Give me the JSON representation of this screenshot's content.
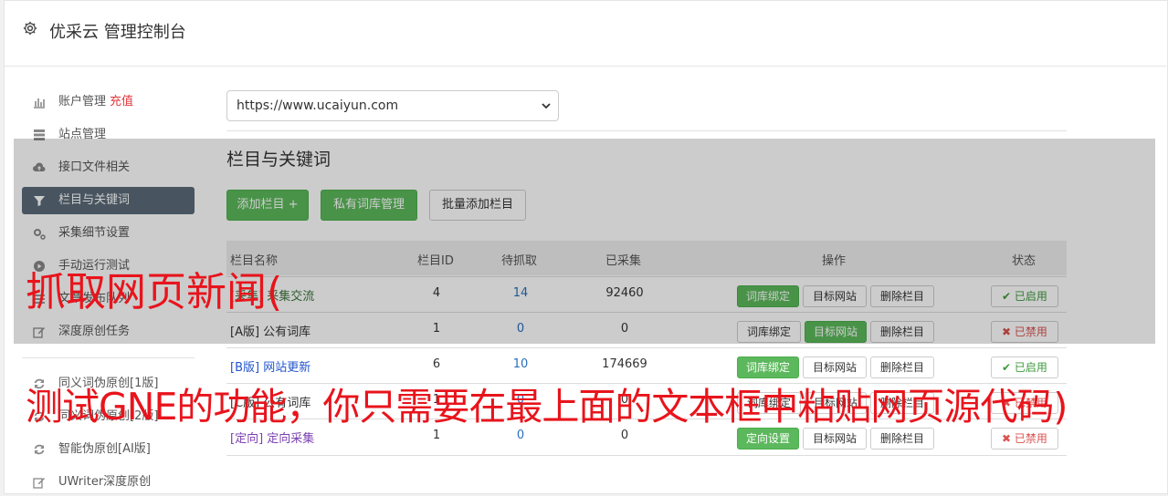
{
  "header": {
    "title": "优采云 管理控制台",
    "icon": "gear-icon"
  },
  "sidebar": {
    "items": [
      {
        "label": "账户管理",
        "extra": "充值",
        "icon": "bar-chart-icon"
      },
      {
        "label": "站点管理",
        "icon": "server-icon"
      },
      {
        "label": "接口文件相关",
        "icon": "cloud-upload-icon"
      },
      {
        "label": "栏目与关键词",
        "icon": "filter-icon",
        "active": true
      },
      {
        "label": "采集细节设置",
        "icon": "cogs-icon"
      },
      {
        "label": "手动运行测试",
        "icon": "play-circle-icon"
      },
      {
        "label": "文章发布队列",
        "icon": "list-icon"
      },
      {
        "label": "深度原创任务",
        "icon": "edit-icon"
      },
      {
        "label": "同义词伪原创[1版]",
        "icon": "refresh-icon"
      },
      {
        "label": "同义词伪原创[2版]",
        "icon": "refresh-icon"
      },
      {
        "label": "智能伪原创[AI版]",
        "icon": "refresh-icon"
      },
      {
        "label": "UWriter深度原创",
        "icon": "edit-icon"
      }
    ]
  },
  "site_select": {
    "value": "https://www.ucaiyun.com"
  },
  "section": {
    "title": "栏目与关键词"
  },
  "toolbar": {
    "add": "添加栏目 +",
    "private": "私有词库管理",
    "batch": "批量添加栏目"
  },
  "table": {
    "headers": [
      "栏目名称",
      "栏目ID",
      "待抓取",
      "已采集",
      "操作",
      "状态"
    ],
    "rows": [
      {
        "name": "[采集] 采集交流",
        "id": "4",
        "pending": "14",
        "collected": "92460",
        "op1": "词库绑定",
        "op2": "目标网站",
        "op3": "删除栏目",
        "status": "已启用",
        "enabled": true
      },
      {
        "name": "[A版] 公有词库",
        "id": "1",
        "pending": "0",
        "collected": "0",
        "op1": "词库绑定",
        "op2": "目标网站",
        "op3": "删除栏目",
        "status": "已禁用",
        "enabled": false
      },
      {
        "name": "[B版] 网站更新",
        "id": "6",
        "pending": "10",
        "collected": "174669",
        "op1": "词库绑定",
        "op2": "目标网站",
        "op3": "删除栏目",
        "status": "已启用",
        "enabled": true
      },
      {
        "name": "[C版] 公有词库",
        "id": "1",
        "pending": "0",
        "collected": "0",
        "op1": "词库绑定",
        "op2": "目标网站",
        "op3": "删除栏目",
        "status": "已禁用",
        "enabled": false
      },
      {
        "name": "[定向] 定向采集",
        "id": "1",
        "pending": "0",
        "collected": "0",
        "op1": "定向设置",
        "op2": "目标网站",
        "op3": "删除栏目",
        "status": "已禁用",
        "enabled": false
      }
    ]
  },
  "captions": {
    "line1": "抓取网页新闻(",
    "line2": "测试GNE的功能，你只需要在最上面的文本框中粘贴网页源代码)"
  },
  "colors": {
    "accent_green": "#5cb85c",
    "sidebar_active": "#5b6b79",
    "caption_red": "#e8141c"
  }
}
